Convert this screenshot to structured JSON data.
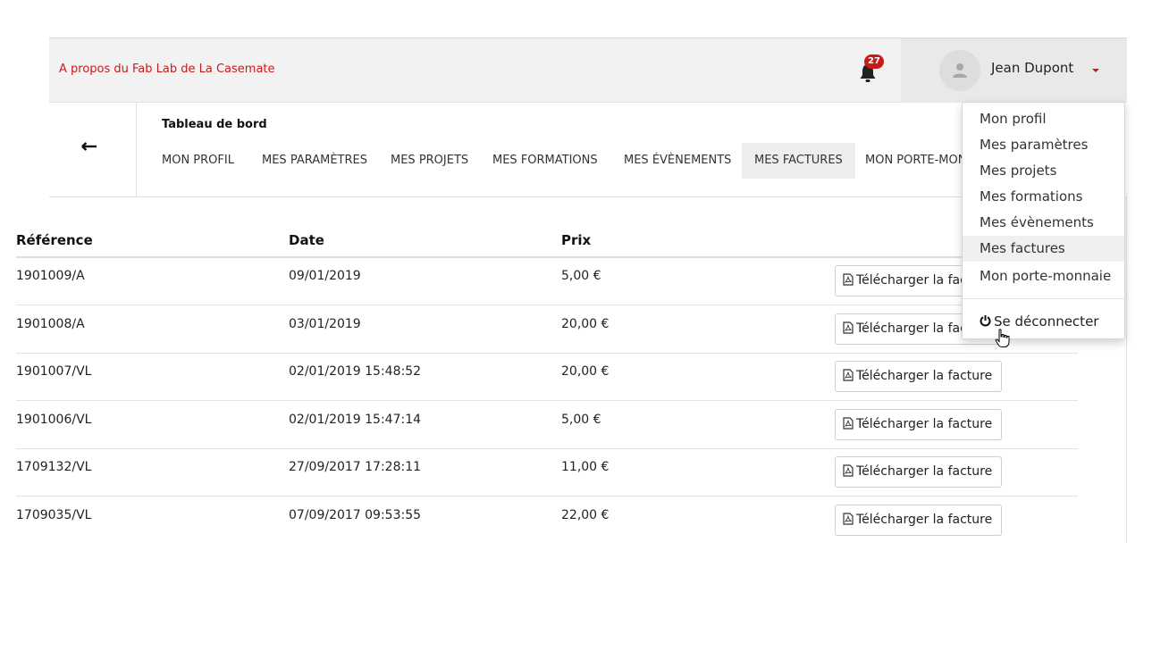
{
  "header": {
    "about_link": "A propos du Fab Lab de La Casemate",
    "notifications_count": "27",
    "user_name": "Jean Dupont",
    "icons": {
      "notifications": "bell-icon",
      "avatar": "user-icon",
      "menu": "caret-down-icon"
    }
  },
  "subnav": {
    "back_icon": "arrow-left-icon",
    "title": "Tableau de bord",
    "tabs": [
      {
        "label": "Mon profil"
      },
      {
        "label": "Mes paramètres"
      },
      {
        "label": "Mes projets"
      },
      {
        "label": "Mes formations"
      },
      {
        "label": "Mes évènements"
      },
      {
        "label": "Mes factures"
      },
      {
        "label": "Mon porte-monnaie"
      }
    ],
    "active_tab": "Mes factures"
  },
  "invoices": {
    "columns": [
      "Référence",
      "Date",
      "Prix"
    ],
    "download_label": "Télécharger la facture",
    "download_icon": "file-pdf-icon",
    "rows": [
      {
        "reference": "1901009/A",
        "date": "09/01/2019",
        "price": "5,00 €"
      },
      {
        "reference": "1901008/A",
        "date": "03/01/2019",
        "price": "20,00 €"
      },
      {
        "reference": "1901007/VL",
        "date": "02/01/2019 15:48:52",
        "price": "20,00 €"
      },
      {
        "reference": "1901006/VL",
        "date": "02/01/2019 15:47:14",
        "price": "5,00 €"
      },
      {
        "reference": "1709132/VL",
        "date": "27/09/2017 17:28:11",
        "price": "11,00 €"
      },
      {
        "reference": "1709035/VL",
        "date": "07/09/2017 09:53:55",
        "price": "22,00 €"
      }
    ]
  },
  "user_menu": {
    "items": [
      {
        "label": "Mon profil"
      },
      {
        "label": "Mes paramètres"
      },
      {
        "label": "Mes projets"
      },
      {
        "label": "Mes formations"
      },
      {
        "label": "Mes évènements"
      },
      {
        "label": "Mes factures"
      },
      {
        "label": "Mon porte-monnaie"
      }
    ],
    "hovered_item": "Mes factures",
    "logout_label": "Se déconnecter",
    "logout_icon": "power-icon"
  },
  "colors": {
    "accent": "#c91a1a",
    "topbar": "#f2f2f2",
    "active_tab": "#eeeeee"
  }
}
